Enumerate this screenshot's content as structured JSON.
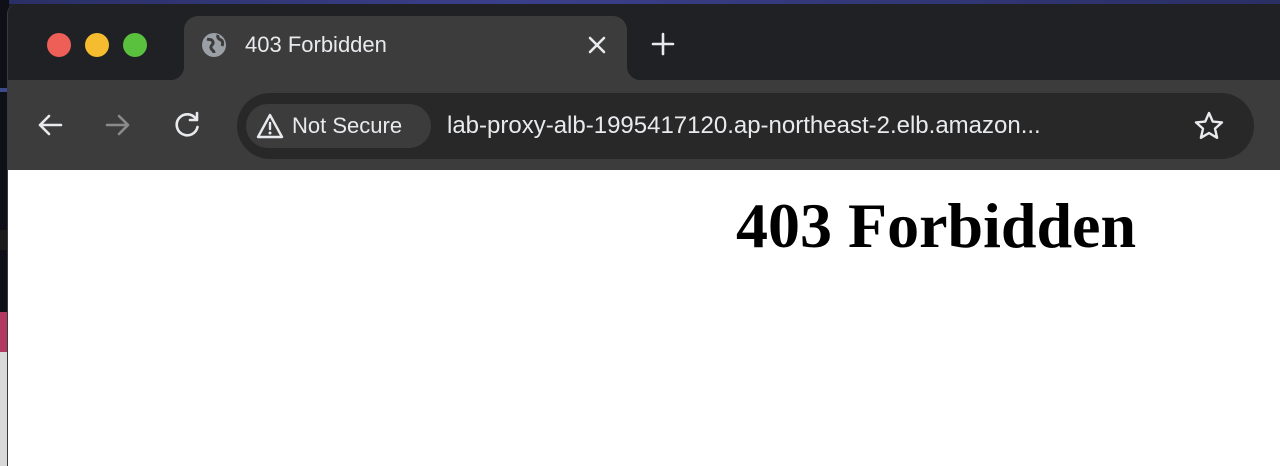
{
  "browser": {
    "tab": {
      "title": "403 Forbidden",
      "favicon": "globe-icon",
      "close_icon": "close-icon"
    },
    "new_tab_icon": "plus-icon",
    "toolbar": {
      "back_icon": "arrow-left-icon",
      "forward_icon": "arrow-right-icon",
      "reload_icon": "reload-icon",
      "security_label": "Not Secure",
      "security_icon": "warning-triangle-icon",
      "url": "lab-proxy-alb-1995417120.ap-northeast-2.elb.amazon...",
      "bookmark_icon": "star-icon"
    }
  },
  "page": {
    "heading": "403 Forbidden"
  },
  "colors": {
    "tabstrip_bg": "#202124",
    "toolbar_bg": "#3c3c3c",
    "omnibox_bg": "#282828",
    "text": "#e8eaed",
    "traffic_red": "#ee5f57",
    "traffic_yellow": "#f6bc2f",
    "traffic_green": "#5ac13f"
  }
}
